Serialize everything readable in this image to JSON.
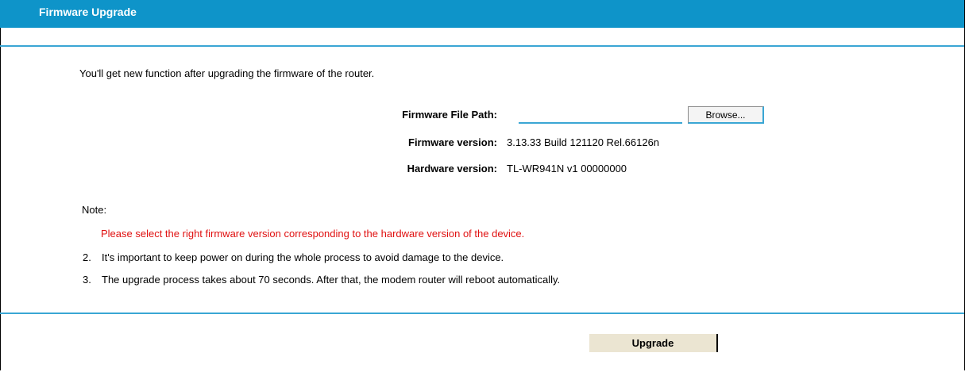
{
  "header": {
    "title": "Firmware Upgrade"
  },
  "intro": "You'll get new function after upgrading the firmware of the router.",
  "form": {
    "file_path_label": "Firmware File Path:",
    "file_path_value": "",
    "browse_label": "Browse...",
    "firmware_version_label": "Firmware version:",
    "firmware_version_value": "3.13.33 Build 121120 Rel.66126n",
    "hardware_version_label": "Hardware version:",
    "hardware_version_value": "TL-WR941N v1 00000000"
  },
  "notes": {
    "title": "Note:",
    "items": [
      "1. Please select the right firmware version corresponding to the hardware version of the device.",
      "2. It's important to keep power on during the whole process to avoid damage to the device.",
      "3. The upgrade process takes about 70 seconds. After that, the modem router will reboot automatically."
    ],
    "item1_text": "Please select the right firmware version corresponding to the hardware version of the device.",
    "item2_num": "2.",
    "item2_text": "It's important to keep power on during the whole process to avoid damage to the device.",
    "item3_num": "3.",
    "item3_text": "The upgrade process takes about 70 seconds. After that, the modem router will reboot automatically."
  },
  "actions": {
    "upgrade_label": "Upgrade"
  },
  "colors": {
    "header_bg": "#0e94c9",
    "accent_line": "#3aa6d4",
    "warning_text": "#e01010",
    "upgrade_button_bg": "#ebe5d2"
  }
}
